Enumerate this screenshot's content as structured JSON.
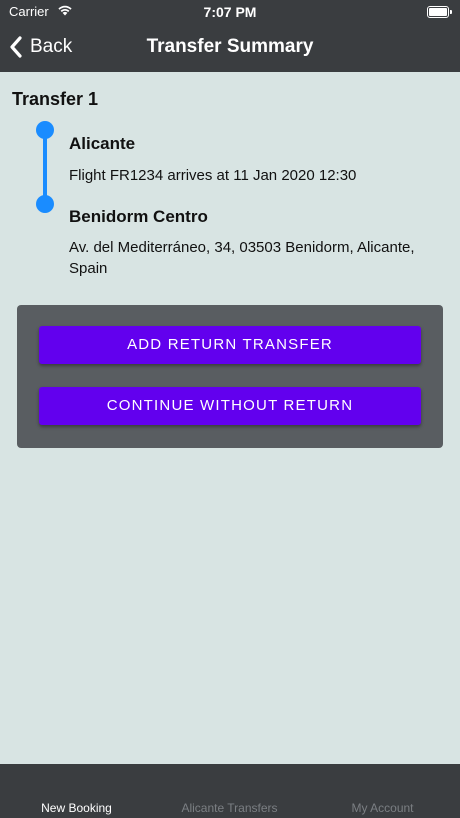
{
  "status_bar": {
    "carrier": "Carrier",
    "time": "7:07 PM",
    "wifi_icon": "wifi-icon",
    "battery_icon": "battery-icon"
  },
  "nav": {
    "back_label": "Back",
    "back_icon": "chevron-left-icon",
    "title": "Transfer Summary"
  },
  "transfer": {
    "heading": "Transfer 1",
    "pickup": {
      "name": "Alicante",
      "detail": "Flight FR1234 arrives at 11 Jan 2020 12:30"
    },
    "dropoff": {
      "name": "Benidorm Centro",
      "detail": "Av. del Mediterráneo, 34, 03503 Benidorm, Alicante, Spain"
    }
  },
  "actions": {
    "add_return": "ADD RETURN TRANSFER",
    "continue_without": "CONTINUE WITHOUT RETURN"
  },
  "tabs": [
    {
      "label": "New Booking",
      "active": true
    },
    {
      "label": "Alicante Transfers",
      "active": false
    },
    {
      "label": "My Account",
      "active": false
    }
  ],
  "colors": {
    "background": "#d8e4e3",
    "bar": "#3a3d40",
    "accent_purple": "#6200ee",
    "timeline_blue": "#1a8cff",
    "card": "#595d61"
  }
}
